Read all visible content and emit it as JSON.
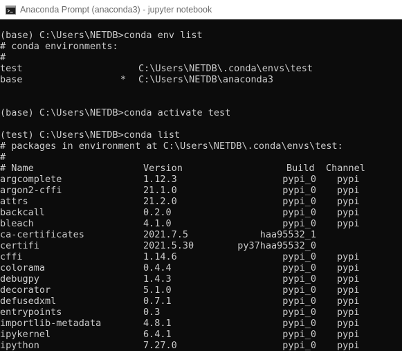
{
  "window": {
    "title": "Anaconda Prompt (anaconda3) - jupyter  notebook"
  },
  "colors": {
    "background": "#0c0c0c",
    "text": "#cccccc",
    "titlebar": "#ffffff"
  },
  "icons": {
    "window": "console-icon"
  },
  "terminal": {
    "cmd_env_list": "(base) C:\\Users\\NETDB>conda env list",
    "env_header": "# conda environments:",
    "env_hash": "#",
    "envs": [
      {
        "name": "test",
        "active": "",
        "path": "C:\\Users\\NETDB\\.conda\\envs\\test"
      },
      {
        "name": "base",
        "active": "*",
        "path": "C:\\Users\\NETDB\\anaconda3"
      }
    ],
    "cmd_activate": "(base) C:\\Users\\NETDB>conda activate test",
    "cmd_list": "(test) C:\\Users\\NETDB>conda list",
    "pkg_header": "# packages in environment at C:\\Users\\NETDB\\.conda\\envs\\test:",
    "pkg_hash": "#",
    "columns": {
      "name": "# Name",
      "version": "Version",
      "build": "Build",
      "channel": "Channel"
    },
    "packages": [
      {
        "name": "argcomplete",
        "version": "1.12.3",
        "build": "pypi_0",
        "channel": "pypi"
      },
      {
        "name": "argon2-cffi",
        "version": "21.1.0",
        "build": "pypi_0",
        "channel": "pypi"
      },
      {
        "name": "attrs",
        "version": "21.2.0",
        "build": "pypi_0",
        "channel": "pypi"
      },
      {
        "name": "backcall",
        "version": "0.2.0",
        "build": "pypi_0",
        "channel": "pypi"
      },
      {
        "name": "bleach",
        "version": "4.1.0",
        "build": "pypi_0",
        "channel": "pypi"
      },
      {
        "name": "ca-certificates",
        "version": "2021.7.5",
        "build": "haa95532_1",
        "channel": ""
      },
      {
        "name": "certifi",
        "version": "2021.5.30",
        "build": "py37haa95532_0",
        "channel": ""
      },
      {
        "name": "cffi",
        "version": "1.14.6",
        "build": "pypi_0",
        "channel": "pypi"
      },
      {
        "name": "colorama",
        "version": "0.4.4",
        "build": "pypi_0",
        "channel": "pypi"
      },
      {
        "name": "debugpy",
        "version": "1.4.3",
        "build": "pypi_0",
        "channel": "pypi"
      },
      {
        "name": "decorator",
        "version": "5.1.0",
        "build": "pypi_0",
        "channel": "pypi"
      },
      {
        "name": "defusedxml",
        "version": "0.7.1",
        "build": "pypi_0",
        "channel": "pypi"
      },
      {
        "name": "entrypoints",
        "version": "0.3",
        "build": "pypi_0",
        "channel": "pypi"
      },
      {
        "name": "importlib-metadata",
        "version": "4.8.1",
        "build": "pypi_0",
        "channel": "pypi"
      },
      {
        "name": "ipykernel",
        "version": "6.4.1",
        "build": "pypi_0",
        "channel": "pypi"
      },
      {
        "name": "ipython",
        "version": "7.27.0",
        "build": "pypi_0",
        "channel": "pypi"
      }
    ]
  }
}
